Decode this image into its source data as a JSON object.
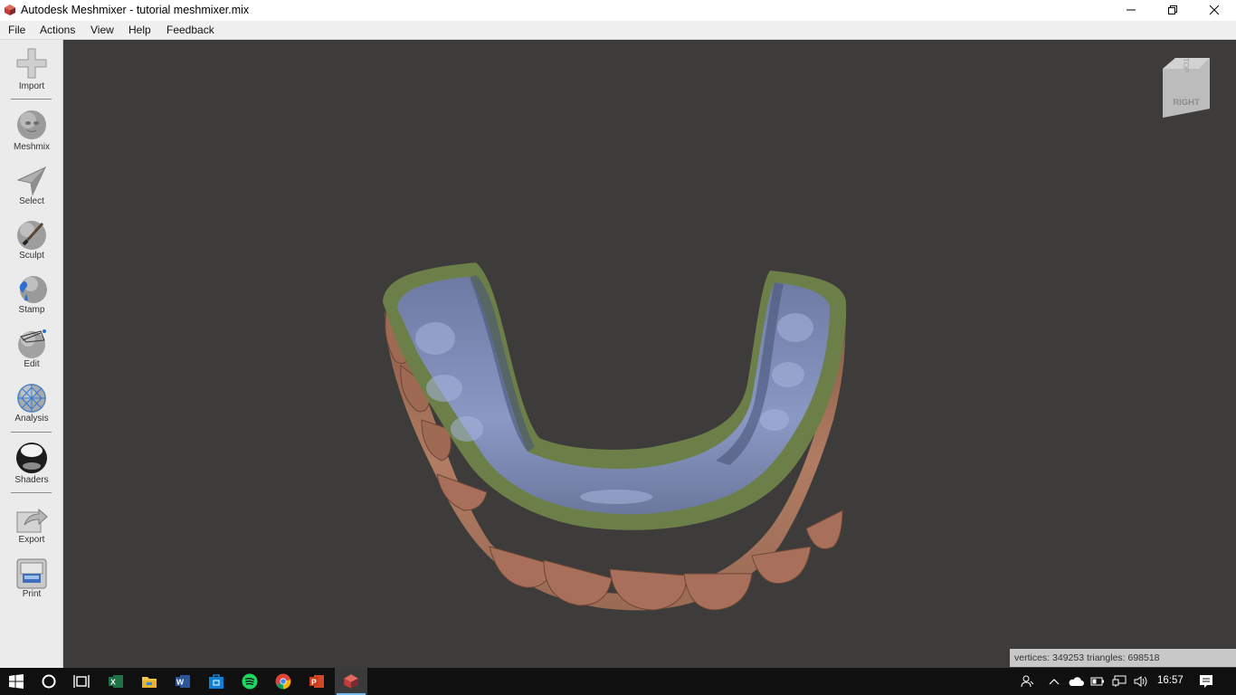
{
  "window": {
    "title": "Autodesk Meshmixer - tutorial meshmixer.mix",
    "controls": {
      "minimize": "minimize-icon",
      "maximize": "restore-icon",
      "close": "close-icon"
    }
  },
  "menu": {
    "items": [
      {
        "label": "File"
      },
      {
        "label": "Actions"
      },
      {
        "label": "View"
      },
      {
        "label": "Help"
      },
      {
        "label": "Feedback"
      }
    ]
  },
  "toolbar": {
    "tools": [
      {
        "label": "Import",
        "icon": "plus-icon"
      },
      {
        "label": "Meshmix",
        "icon": "head-sphere-icon"
      },
      {
        "label": "Select",
        "icon": "arrow-pointer-icon"
      },
      {
        "label": "Sculpt",
        "icon": "brush-sphere-icon"
      },
      {
        "label": "Stamp",
        "icon": "stamp-sphere-icon"
      },
      {
        "label": "Edit",
        "icon": "edit-sphere-icon"
      },
      {
        "label": "Analysis",
        "icon": "mesh-sphere-icon"
      },
      {
        "label": "Shaders",
        "icon": "chrome-sphere-icon"
      },
      {
        "label": "Export",
        "icon": "export-icon"
      },
      {
        "label": "Print",
        "icon": "printer-icon"
      }
    ]
  },
  "viewport": {
    "viewcube": {
      "face": "RIGHT",
      "top": "TOP"
    },
    "status": "vertices: 349253 triangles: 698518",
    "colors": {
      "background": "#3d3c3b",
      "rim": "#6d7f48",
      "inner": "#7f8db5",
      "teeth": "#a9715a"
    }
  },
  "taskbar": {
    "apps": [
      {
        "name": "start",
        "icon": "windows-icon"
      },
      {
        "name": "search",
        "icon": "cortana-icon"
      },
      {
        "name": "task-view",
        "icon": "task-view-icon"
      },
      {
        "name": "excel",
        "icon": "excel-icon"
      },
      {
        "name": "file-explorer",
        "icon": "folder-icon"
      },
      {
        "name": "word",
        "icon": "word-icon"
      },
      {
        "name": "store",
        "icon": "store-icon"
      },
      {
        "name": "spotify",
        "icon": "spotify-icon"
      },
      {
        "name": "chrome",
        "icon": "chrome-icon"
      },
      {
        "name": "powerpoint",
        "icon": "powerpoint-icon"
      },
      {
        "name": "meshmixer",
        "icon": "meshmixer-icon"
      }
    ],
    "time": "16:57"
  }
}
